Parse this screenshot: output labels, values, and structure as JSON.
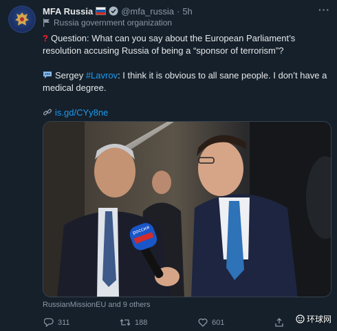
{
  "tweet": {
    "author_name": "MFA Russia",
    "handle": "@mfa_russia",
    "separator": "·",
    "time": "5h",
    "label": "Russia government organization",
    "question_prefix": "Question: What can you say about the European Parliament’s resolution accusing Russia of being a “sponsor of terrorism”?",
    "answer_prefix": "Sergey ",
    "answer_hashtag": "#Lavrov",
    "answer_text": ": I think it is obvious to all sane people. I don’t have a medical degree.",
    "link": "is.gd/CYy8ne",
    "tagged": "RussianMissionEU and 9 others",
    "mic_label": "россия"
  },
  "actions": {
    "replies": "311",
    "retweets": "188",
    "likes": "601"
  },
  "watermark": "环球网",
  "icons": [
    "coat-of-arms-icon",
    "russian-flag-icon",
    "verified-badge-icon",
    "more-icon",
    "government-flag-icon",
    "question-mark-icon",
    "speech-bubble-icon",
    "link-icon",
    "reply-icon",
    "retweet-icon",
    "like-icon",
    "share-icon"
  ],
  "colors": {
    "background": "#15202b",
    "text": "#e7e9ea",
    "muted": "#8b98a5",
    "accent": "#1d9bf0"
  }
}
